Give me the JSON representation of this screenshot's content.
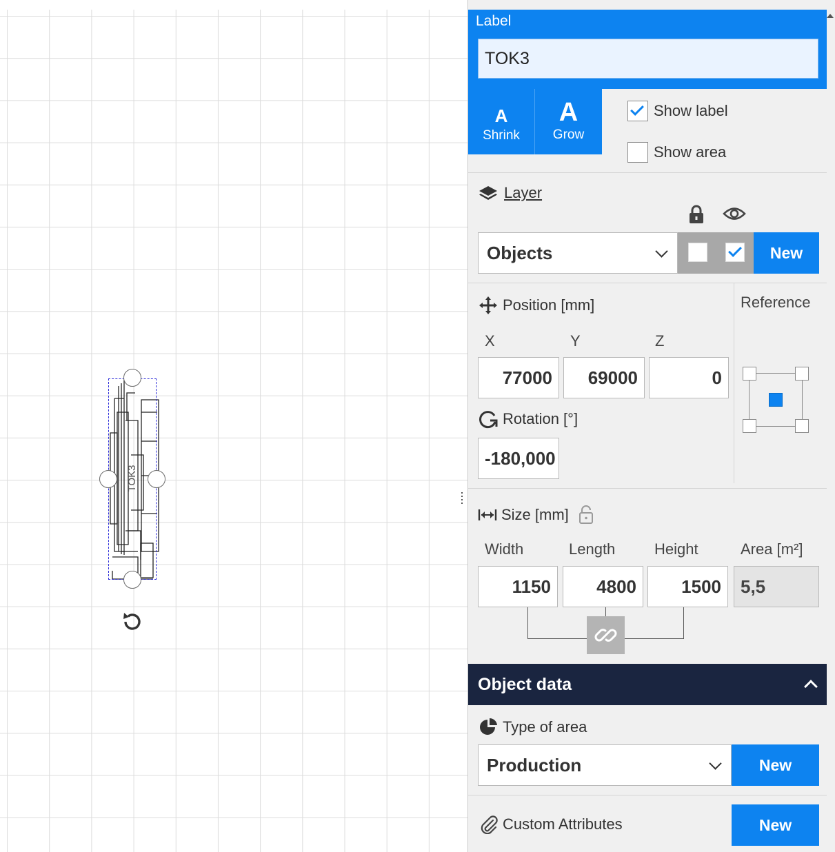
{
  "canvas": {
    "object_label": "TOK3"
  },
  "panel": {
    "label": {
      "title": "Label",
      "value": "TOK3"
    },
    "font": {
      "shrink_glyph": "A",
      "shrink_label": "Shrink",
      "grow_glyph": "A",
      "grow_label": "Grow"
    },
    "show_label": {
      "text": "Show label",
      "checked": true
    },
    "show_area": {
      "text": "Show area",
      "checked": false
    },
    "layer": {
      "title": "Layer",
      "selected": "Objects",
      "locked": false,
      "visible": true,
      "new_label": "New"
    },
    "position": {
      "title": "Position [mm]",
      "x_label": "X",
      "y_label": "Y",
      "z_label": "Z",
      "x": "77000",
      "y": "69000",
      "z": "0",
      "rotation_title": "Rotation [°]",
      "rotation": "-180,000",
      "reference_title": "Reference",
      "reference_selected": "center"
    },
    "size": {
      "title": "Size [mm]",
      "width_label": "Width",
      "length_label": "Length",
      "height_label": "Height",
      "area_label": "Area [m²]",
      "width": "1150",
      "length": "4800",
      "height": "1500",
      "area": "5,5",
      "proportions_linked": true
    },
    "object_data": {
      "header": "Object data",
      "type_of_area_title": "Type of area",
      "type_of_area": "Production",
      "new_label": "New",
      "custom_attributes_title": "Custom Attributes",
      "custom_attributes_new": "New"
    }
  },
  "colors": {
    "accent": "#0d83f0",
    "header_dark": "#1a2540",
    "selection": "#2a2ad8",
    "panel_bg": "#f0f0f0",
    "grid": "#dcdcdc"
  }
}
